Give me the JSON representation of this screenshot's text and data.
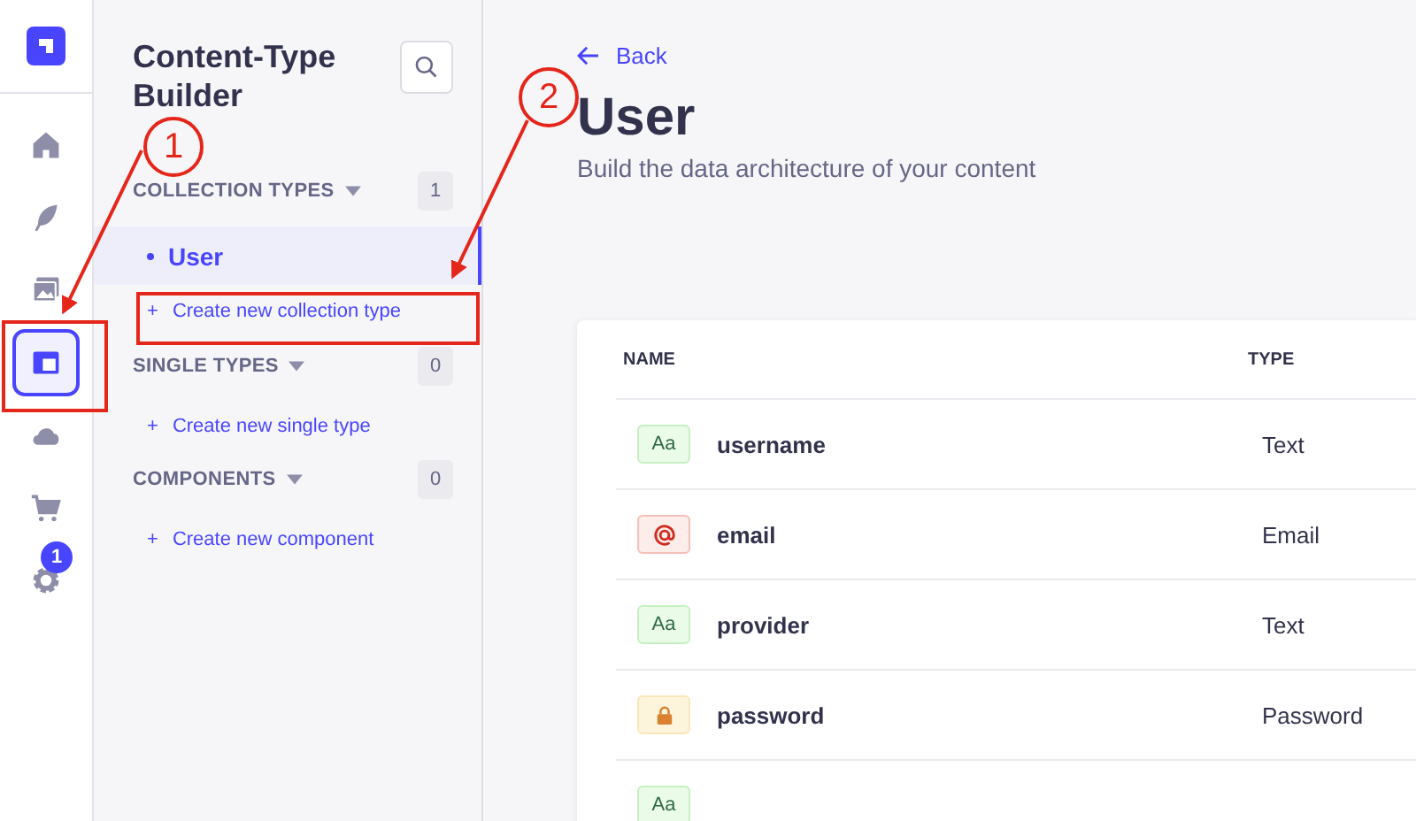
{
  "nav": {
    "items": [
      {
        "kind": "home",
        "selected": false
      },
      {
        "kind": "feather",
        "selected": false
      },
      {
        "kind": "images",
        "selected": false
      },
      {
        "kind": "layout",
        "selected": true
      },
      {
        "kind": "cloud",
        "selected": false
      },
      {
        "kind": "cart",
        "selected": false
      },
      {
        "kind": "gear",
        "selected": false,
        "badge": "1"
      }
    ]
  },
  "sidebar": {
    "title": "Content-Type Builder",
    "sections": [
      {
        "label": "COLLECTION TYPES",
        "count": "1",
        "items": [
          {
            "label": "User",
            "selected": true
          }
        ],
        "create_icon": "+",
        "create": "Create new collection type"
      },
      {
        "label": "SINGLE TYPES",
        "count": "0",
        "create_icon": "+",
        "create": "Create new single type"
      },
      {
        "label": "COMPONENTS",
        "count": "0",
        "create_icon": "+",
        "create": "Create new component"
      }
    ]
  },
  "header": {
    "back": "Back",
    "title": "User",
    "subtitle": "Build the data architecture of your content"
  },
  "table": {
    "columns": [
      "NAME",
      "TYPE"
    ],
    "rows": [
      {
        "kind": "text",
        "icon_text": "Aa",
        "name": "username",
        "type": "Text"
      },
      {
        "kind": "email",
        "name": "email",
        "type": "Email"
      },
      {
        "kind": "text",
        "icon_text": "Aa",
        "name": "provider",
        "type": "Text"
      },
      {
        "kind": "password",
        "name": "password",
        "type": "Password"
      },
      {
        "kind": "text",
        "icon_text": "Aa"
      }
    ]
  },
  "annotations": [
    {
      "label": "1"
    },
    {
      "label": "2"
    }
  ]
}
